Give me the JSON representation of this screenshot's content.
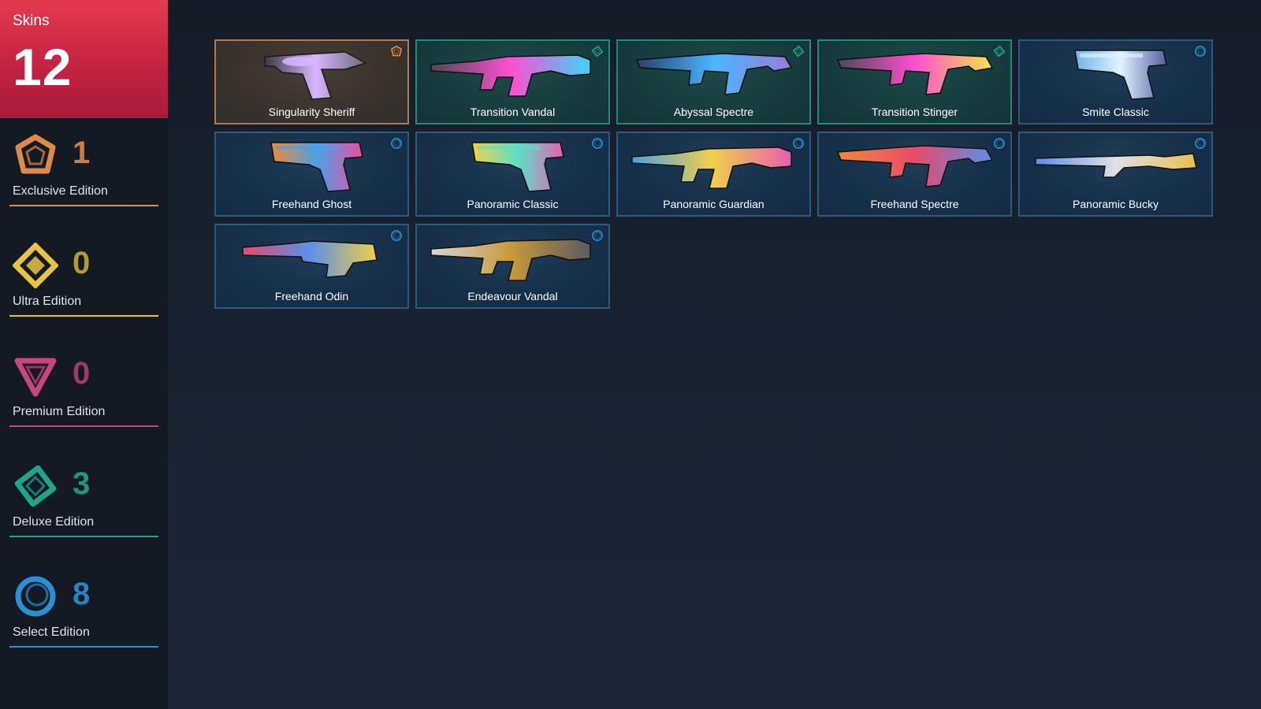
{
  "summary": {
    "label": "Skins",
    "total": "12"
  },
  "colors": {
    "exclusive": "#e0894a",
    "ultra": "#e7c441",
    "premium": "#c8467f",
    "deluxe": "#1fa68a",
    "select": "#2a8fd4"
  },
  "tiers": [
    {
      "key": "exclusive",
      "count": "1",
      "label": "Exclusive Edition",
      "icon": "exclusive-edition-icon"
    },
    {
      "key": "ultra",
      "count": "0",
      "label": "Ultra Edition",
      "icon": "ultra-edition-icon"
    },
    {
      "key": "premium",
      "count": "0",
      "label": "Premium Edition",
      "icon": "premium-edition-icon"
    },
    {
      "key": "deluxe",
      "count": "3",
      "label": "Deluxe Edition",
      "icon": "deluxe-edition-icon"
    },
    {
      "key": "select",
      "count": "8",
      "label": "Select Edition",
      "icon": "select-edition-icon"
    }
  ],
  "skins": [
    {
      "name": "Singularity Sheriff",
      "tier": "exclusive",
      "icon": "revolver-icon"
    },
    {
      "name": "Transition Vandal",
      "tier": "deluxe",
      "icon": "rifle-icon"
    },
    {
      "name": "Abyssal Spectre",
      "tier": "deluxe",
      "icon": "smg-icon"
    },
    {
      "name": "Transition Stinger",
      "tier": "deluxe",
      "icon": "smg-icon"
    },
    {
      "name": "Smite Classic",
      "tier": "select",
      "icon": "pistol-icon"
    },
    {
      "name": "Freehand Ghost",
      "tier": "select",
      "icon": "pistol-icon"
    },
    {
      "name": "Panoramic Classic",
      "tier": "select",
      "icon": "pistol-icon"
    },
    {
      "name": "Panoramic Guardian",
      "tier": "select",
      "icon": "rifle-icon"
    },
    {
      "name": "Freehand Spectre",
      "tier": "select",
      "icon": "smg-icon"
    },
    {
      "name": "Panoramic Bucky",
      "tier": "select",
      "icon": "shotgun-icon"
    },
    {
      "name": "Freehand Odin",
      "tier": "select",
      "icon": "machine-gun-icon"
    },
    {
      "name": "Endeavour Vandal",
      "tier": "select",
      "icon": "rifle-icon"
    }
  ]
}
